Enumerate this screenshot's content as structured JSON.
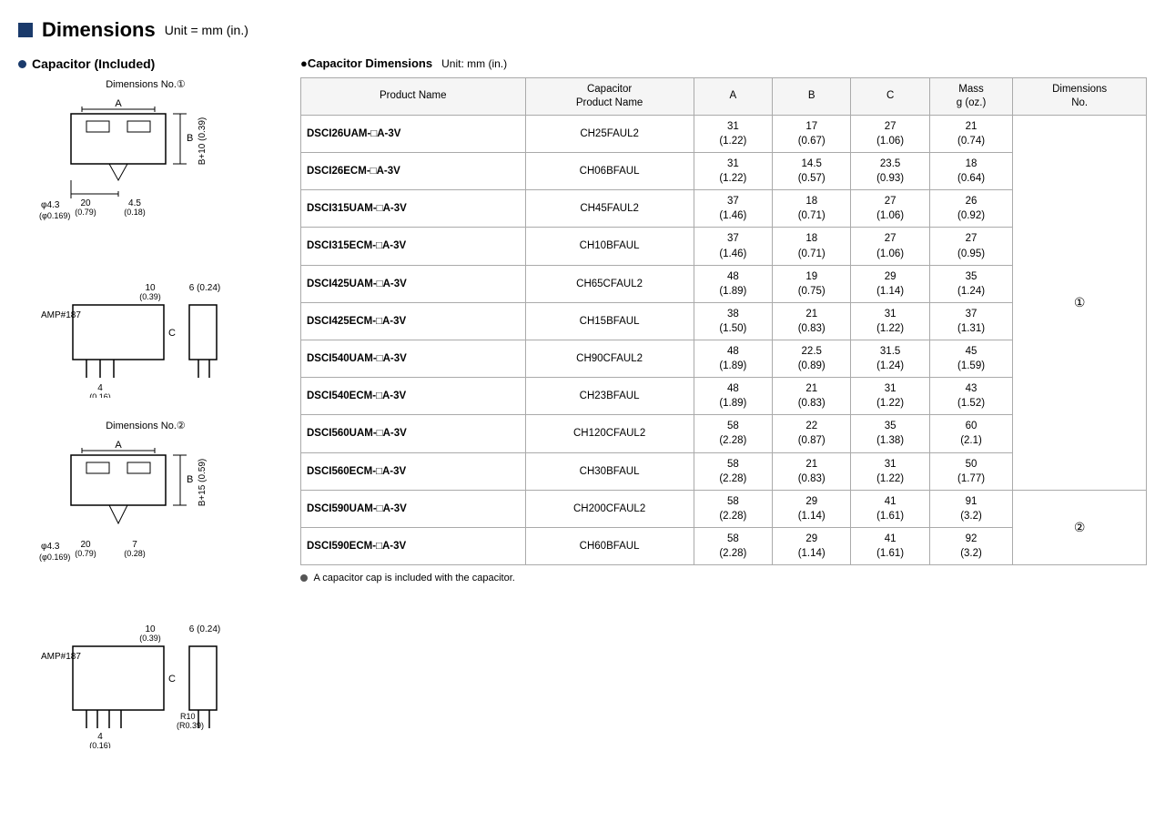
{
  "page": {
    "title": "Dimensions",
    "unit": "Unit = mm (in.)"
  },
  "left": {
    "section_title": "Capacitor (Included)",
    "dim1_label": "Dimensions No.①",
    "dim2_label": "Dimensions No.②",
    "bullet_char": "●"
  },
  "right": {
    "cap_dim_title": "●Capacitor Dimensions",
    "cap_dim_unit": "Unit: mm (in.)",
    "headers": {
      "product_name": "Product Name",
      "cap_product_name": "Capacitor\nProduct Name",
      "a": "A",
      "b": "B",
      "c": "C",
      "mass": "Mass\ng (oz.)",
      "dim_no": "Dimensions\nNo."
    },
    "rows": [
      {
        "product": "DSCI26UAM-□A-3V",
        "cap": "CH25FAUL2",
        "a": "31\n(1.22)",
        "b": "17\n(0.67)",
        "c": "27\n(1.06)",
        "mass": "21\n(0.74)",
        "dim_no": "①"
      },
      {
        "product": "DSCI26ECM-□A-3V",
        "cap": "CH06BFAUL",
        "a": "31\n(1.22)",
        "b": "14.5\n(0.57)",
        "c": "23.5\n(0.93)",
        "mass": "18\n(0.64)",
        "dim_no": ""
      },
      {
        "product": "DSCI315UAM-□A-3V",
        "cap": "CH45FAUL2",
        "a": "37\n(1.46)",
        "b": "18\n(0.71)",
        "c": "27\n(1.06)",
        "mass": "26\n(0.92)",
        "dim_no": ""
      },
      {
        "product": "DSCI315ECM-□A-3V",
        "cap": "CH10BFAUL",
        "a": "37\n(1.46)",
        "b": "18\n(0.71)",
        "c": "27\n(1.06)",
        "mass": "27\n(0.95)",
        "dim_no": ""
      },
      {
        "product": "DSCI425UAM-□A-3V",
        "cap": "CH65CFAUL2",
        "a": "48\n(1.89)",
        "b": "19\n(0.75)",
        "c": "29\n(1.14)",
        "mass": "35\n(1.24)",
        "dim_no": ""
      },
      {
        "product": "DSCI425ECM-□A-3V",
        "cap": "CH15BFAUL",
        "a": "38\n(1.50)",
        "b": "21\n(0.83)",
        "c": "31\n(1.22)",
        "mass": "37\n(1.31)",
        "dim_no": "①"
      },
      {
        "product": "DSCI540UAM-□A-3V",
        "cap": "CH90CFAUL2",
        "a": "48\n(1.89)",
        "b": "22.5\n(0.89)",
        "c": "31.5\n(1.24)",
        "mass": "45\n(1.59)",
        "dim_no": ""
      },
      {
        "product": "DSCI540ECM-□A-3V",
        "cap": "CH23BFAUL",
        "a": "48\n(1.89)",
        "b": "21\n(0.83)",
        "c": "31\n(1.22)",
        "mass": "43\n(1.52)",
        "dim_no": ""
      },
      {
        "product": "DSCI560UAM-□A-3V",
        "cap": "CH120CFAUL2",
        "a": "58\n(2.28)",
        "b": "22\n(0.87)",
        "c": "35\n(1.38)",
        "mass": "60\n(2.1)",
        "dim_no": ""
      },
      {
        "product": "DSCI560ECM-□A-3V",
        "cap": "CH30BFAUL",
        "a": "58\n(2.28)",
        "b": "21\n(0.83)",
        "c": "31\n(1.22)",
        "mass": "50\n(1.77)",
        "dim_no": ""
      },
      {
        "product": "DSCI590UAM-□A-3V",
        "cap": "CH200CFAUL2",
        "a": "58\n(2.28)",
        "b": "29\n(1.14)",
        "c": "41\n(1.61)",
        "mass": "91\n(3.2)",
        "dim_no": ""
      },
      {
        "product": "DSCI590ECM-□A-3V",
        "cap": "CH60BFAUL",
        "a": "58\n(2.28)",
        "b": "29\n(1.14)",
        "c": "41\n(1.61)",
        "mass": "92\n(3.2)",
        "dim_no": "②"
      }
    ],
    "note": "A capacitor cap is included with the capacitor."
  }
}
